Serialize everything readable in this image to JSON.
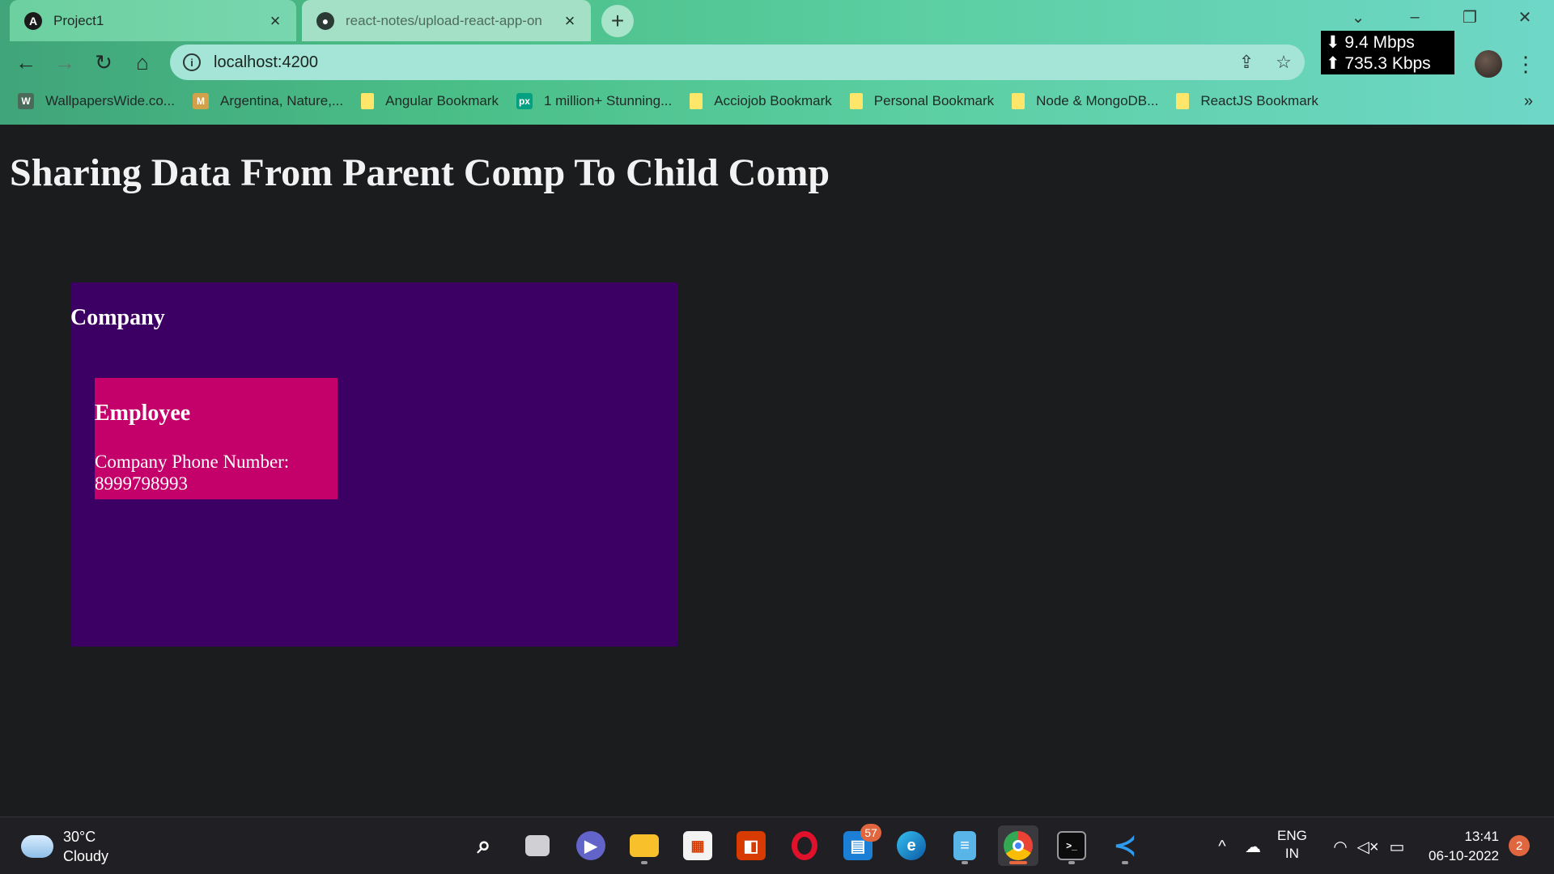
{
  "tabs": [
    {
      "title": "Project1",
      "icon": "angular-icon",
      "active": true
    },
    {
      "title": "react-notes/upload-react-app-on",
      "icon": "github-icon",
      "active": false
    }
  ],
  "window": {
    "minimize": "–",
    "restore": "❐",
    "close": "✕",
    "tab_search": "⌄"
  },
  "netspeed": {
    "down": "⬇ 9.4 Mbps",
    "up": "⬆ 735.3 Kbps"
  },
  "address_bar": {
    "url": "localhost:4200"
  },
  "bookmarks": [
    {
      "label": "WallpapersWide.co...",
      "icon": "wallpaperswide-icon",
      "color": "#4a6a5a",
      "glyph": "W"
    },
    {
      "label": "Argentina, Nature,...",
      "icon": "unsplash-icon",
      "color": "#d2a14a",
      "glyph": "M"
    },
    {
      "label": "Angular Bookmark",
      "icon": "folder-icon",
      "color": "#fde66a",
      "glyph": ""
    },
    {
      "label": "1 million+ Stunning...",
      "icon": "pexels-icon",
      "color": "#05a081",
      "glyph": "px"
    },
    {
      "label": "Acciojob Bookmark",
      "icon": "folder-icon",
      "color": "#fde66a",
      "glyph": ""
    },
    {
      "label": "Personal Bookmark",
      "icon": "folder-icon",
      "color": "#fde66a",
      "glyph": ""
    },
    {
      "label": "Node & MongoDB...",
      "icon": "folder-icon",
      "color": "#fde66a",
      "glyph": ""
    },
    {
      "label": "ReactJS Bookmark",
      "icon": "folder-icon",
      "color": "#fde66a",
      "glyph": ""
    }
  ],
  "bookmarks_more": "»",
  "page": {
    "title": "Sharing Data From Parent Comp To Child Comp",
    "company": {
      "title": "Company",
      "bg": "#3c0065"
    },
    "employee": {
      "title": "Employee",
      "phone_label": "Company Phone Number:",
      "phone_value": "8999798993",
      "bg": "#c4006b"
    }
  },
  "taskbar": {
    "weather": {
      "temp": "30°C",
      "condition": "Cloudy"
    },
    "notes_badge": "57",
    "tray": {
      "lang1": "ENG",
      "lang2": "IN"
    },
    "clock": {
      "time": "13:41",
      "date": "06-10-2022"
    },
    "notifications": "2"
  }
}
